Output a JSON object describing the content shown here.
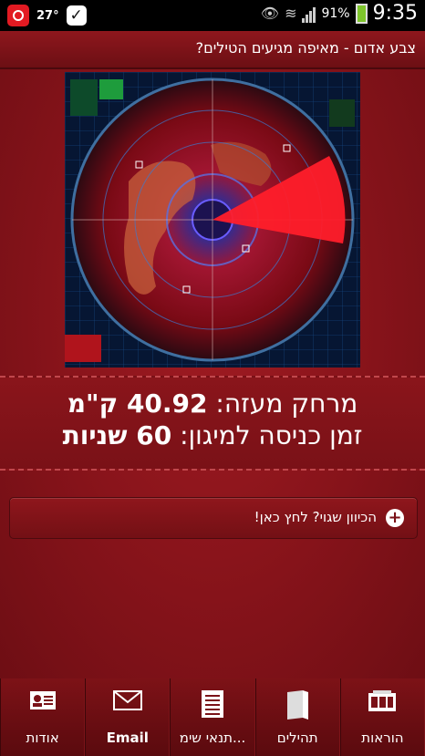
{
  "statusbar": {
    "temperature": "27°",
    "battery_percent": "91%",
    "time": "9:35"
  },
  "appbar": {
    "title": "צבע אדום - מאיפה מגיעים הטילים?"
  },
  "info": {
    "distance_label": "מרחק מעזה:",
    "distance_value": "40.92 ק\"מ",
    "entry_label": "זמן כניסה למיגון:",
    "entry_value": "60 שניות"
  },
  "direction_button": {
    "label": "הכיוון שגוי? לחץ כאן!"
  },
  "bottom_nav": {
    "items": [
      {
        "label": "אודות",
        "icon": "contact-card-icon"
      },
      {
        "label": "Email",
        "icon": "envelope-icon"
      },
      {
        "label": "תנאי שימ...",
        "icon": "document-icon"
      },
      {
        "label": "תהילים",
        "icon": "book-icon"
      },
      {
        "label": "הוראות",
        "icon": "instructions-icon"
      }
    ]
  }
}
